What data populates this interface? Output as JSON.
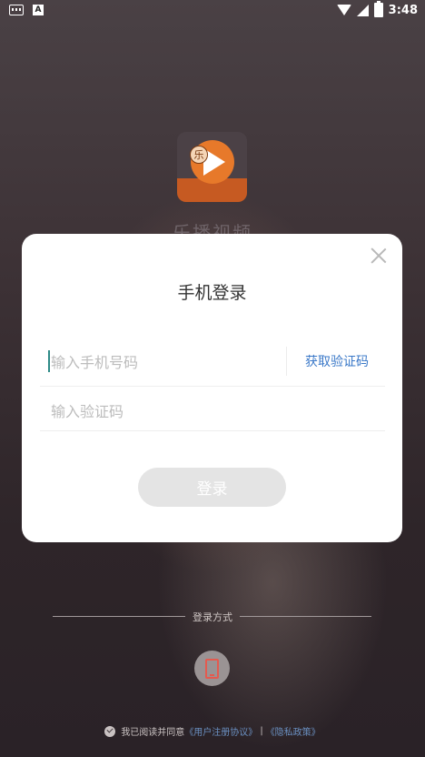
{
  "status_bar": {
    "time": "3:48",
    "left_icons": [
      "keyboard-icon",
      "a-icon"
    ],
    "right_icons": [
      "wifi-icon",
      "signal-icon",
      "battery-icon"
    ],
    "a_label": "A"
  },
  "app": {
    "name": "乐播视频",
    "logo_char": "乐"
  },
  "dialog": {
    "title": "手机登录",
    "phone_placeholder": "输入手机号码",
    "code_placeholder": "输入验证码",
    "get_code_label": "获取验证码",
    "login_label": "登录"
  },
  "login_methods": {
    "label": "登录方式"
  },
  "agreement": {
    "prefix": "我已阅读并同意",
    "user_agreement": "《用户注册协议》",
    "separator": "|",
    "privacy_policy": "《隐私政策》"
  },
  "colors": {
    "accent": "#3a78c8",
    "brand_orange": "#e7792a",
    "disabled_button": "#e4e4e4"
  }
}
